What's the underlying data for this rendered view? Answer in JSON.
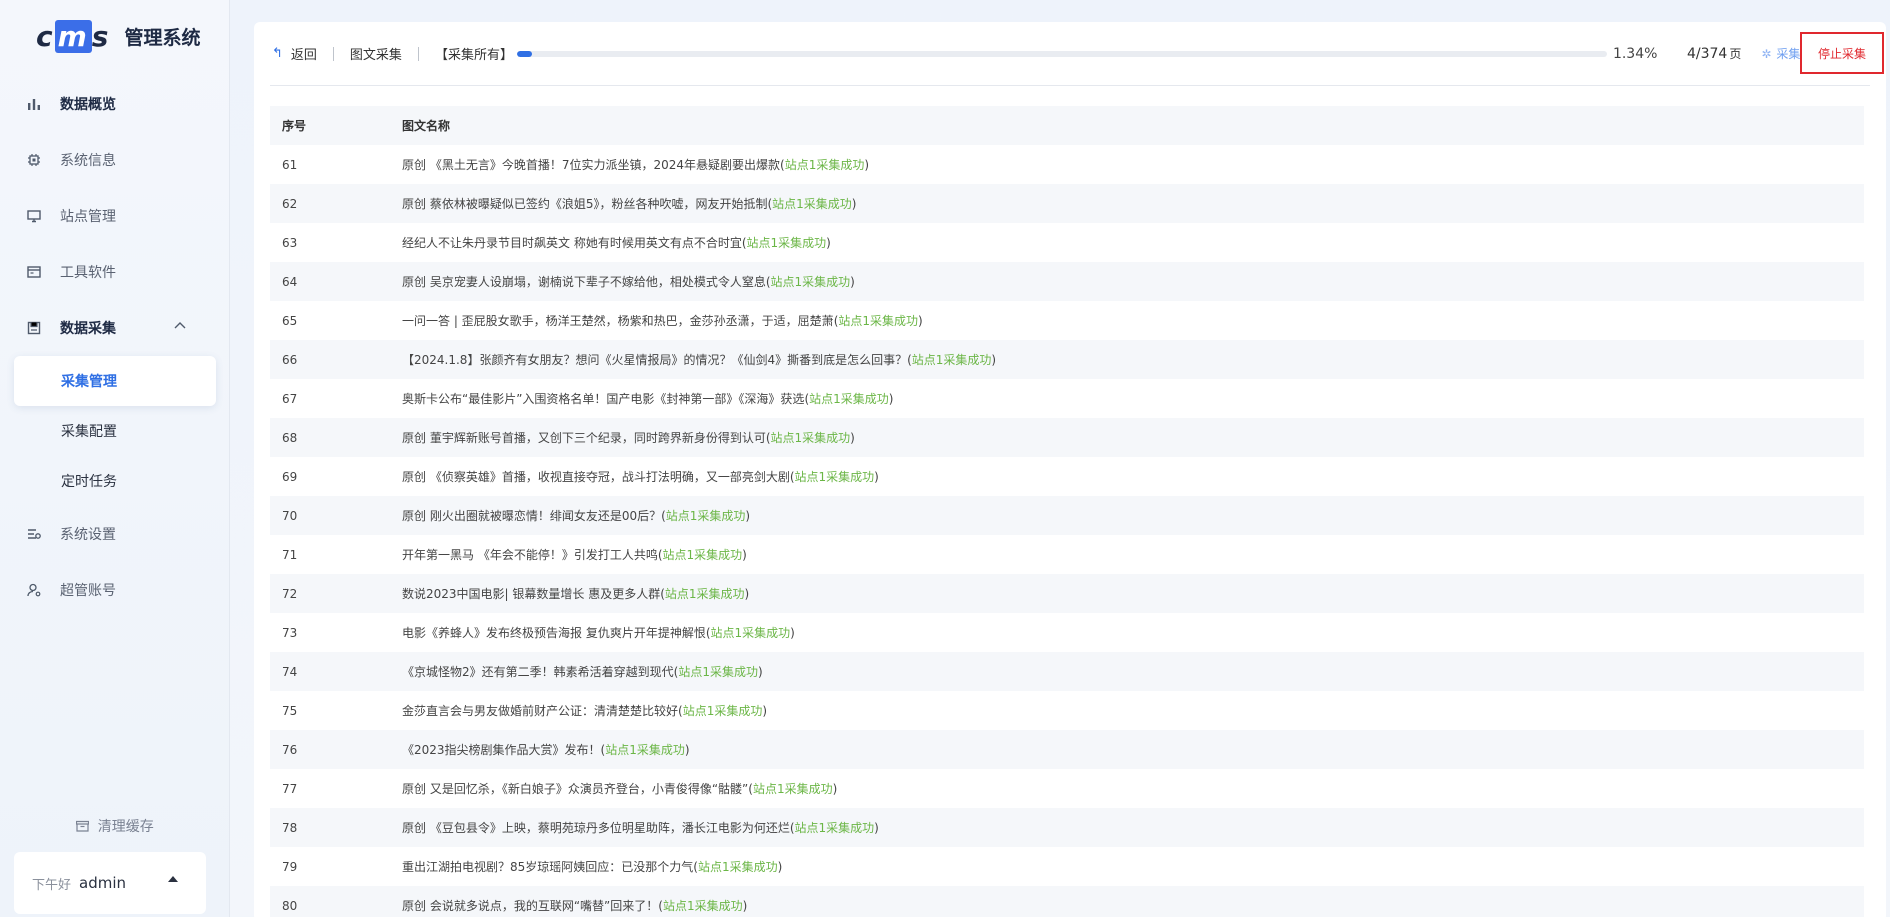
{
  "app": {
    "logo": "cms",
    "title": "管理系统"
  },
  "sidebar": {
    "items": [
      {
        "label": "数据概览",
        "icon": "bar-chart-icon"
      },
      {
        "label": "系统信息",
        "icon": "chip-icon"
      },
      {
        "label": "站点管理",
        "icon": "monitor-icon"
      },
      {
        "label": "工具软件",
        "icon": "window-icon"
      },
      {
        "label": "数据采集",
        "icon": "save-icon"
      }
    ],
    "sub_items": [
      {
        "label": "采集管理"
      },
      {
        "label": "采集配置"
      },
      {
        "label": "定时任务"
      }
    ],
    "items_after": [
      {
        "label": "系统设置",
        "icon": "settings-list-icon"
      },
      {
        "label": "超管账号",
        "icon": "user-gear-icon"
      }
    ],
    "clear_cache": "清理缓存",
    "greeting": "下午好",
    "username": "admin"
  },
  "toolbar": {
    "back": "返回",
    "category": "图文采集",
    "progress_label": "【采集所有】",
    "progress": 0.0134,
    "percent": "1.34%",
    "pages": "4/374",
    "pages_unit": "页",
    "status": "采集中",
    "stop": "停止采集"
  },
  "table": {
    "columns": [
      "序号",
      "图文名称"
    ],
    "success_suffix": "站点1采集成功",
    "rows": [
      {
        "no": "61",
        "title": "原创 《黑土无言》今晚首播！7位实力派坐镇，2024年悬疑剧要出爆款"
      },
      {
        "no": "62",
        "title": "原创 蔡依林被曝疑似已签约《浪姐5》，粉丝各种吹嘘，网友开始抵制"
      },
      {
        "no": "63",
        "title": "经纪人不让朱丹录节目时飙英文 称她有时候用英文有点不合时宜"
      },
      {
        "no": "64",
        "title": "原创 吴京宠妻人设崩塌，谢楠说下辈子不嫁给他，相处模式令人窒息"
      },
      {
        "no": "65",
        "title": "一问一答 | 歪屁股女歌手，杨洋王楚然，杨紫和热巴，金莎孙丞潇，于适，屈楚萧"
      },
      {
        "no": "66",
        "title": "【2024.1.8】张颜齐有女朋友？想问《火星情报局》的情况？《仙剑4》撕番到底是怎么回事？"
      },
      {
        "no": "67",
        "title": "奥斯卡公布“最佳影片”入围资格名单！国产电影《封神第一部》《深海》获选"
      },
      {
        "no": "68",
        "title": "原创 董宇辉新账号首播，又创下三个纪录，同时跨界新身份得到认可"
      },
      {
        "no": "69",
        "title": "原创 《侦察英雄》首播，收视直接夺冠，战斗打法明确，又一部亮剑大剧"
      },
      {
        "no": "70",
        "title": "原创 刚火出圈就被曝恋情！绯闻女友还是00后？"
      },
      {
        "no": "71",
        "title": "开年第一黑马 《年会不能停！》引发打工人共鸣"
      },
      {
        "no": "72",
        "title": "数说2023中国电影| 银幕数量增长 惠及更多人群"
      },
      {
        "no": "73",
        "title": "电影《养蜂人》发布终极预告海报 复仇爽片开年提神解恨"
      },
      {
        "no": "74",
        "title": "《京城怪物2》还有第二季！韩素希活着穿越到现代"
      },
      {
        "no": "75",
        "title": "金莎直言会与男友做婚前财产公证：清清楚楚比较好"
      },
      {
        "no": "76",
        "title": "《2023指尖榜剧集作品大赏》发布！"
      },
      {
        "no": "77",
        "title": "原创 又是回忆杀，《新白娘子》众演员齐登台，小青俊得像“骷髅”"
      },
      {
        "no": "78",
        "title": "原创 《豆包县令》上映，蔡明苑琼丹多位明星助阵，潘长江电影为何还烂"
      },
      {
        "no": "79",
        "title": "重出江湖拍电视剧？85岁琼瑶阿姨回应：已没那个力气"
      },
      {
        "no": "80",
        "title": "原创 会说就多说点，我的互联网“嘴替”回来了！"
      }
    ]
  }
}
